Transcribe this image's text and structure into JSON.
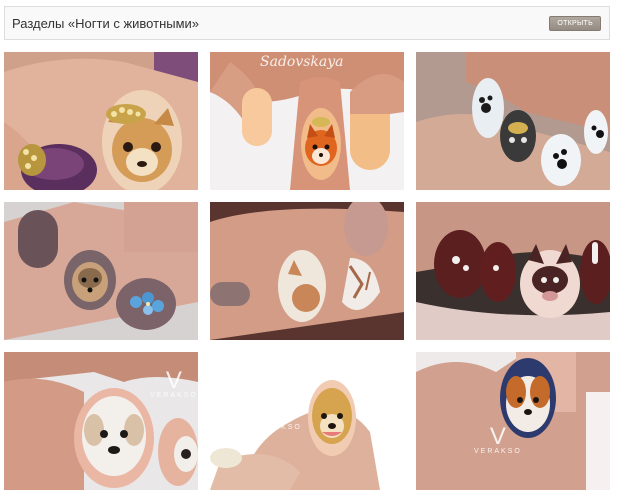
{
  "header": {
    "title": "Разделы «Ногти с животными»",
    "open_button": "ОТКРЫТЬ"
  },
  "gallery": {
    "tiles": [
      {
        "theme": "purple nails with gold crystals and chihuahua portrait"
      },
      {
        "theme": "peach almond nails with orange fox",
        "watermark": "Sadovskaya"
      },
      {
        "theme": "white nails with black paw prints and dog"
      },
      {
        "theme": "mauve nails with yorkie and blue flowers"
      },
      {
        "theme": "nude nails with white fox"
      },
      {
        "theme": "burgundy nails with french bulldog and paws"
      },
      {
        "theme": "white maltese dog portrait nail",
        "watermark": "VERAKSO"
      },
      {
        "theme": "pomeranian portrait nail",
        "watermark": "VERAKSO"
      },
      {
        "theme": "navy nail with beagle portrait",
        "watermark": "VERAKSO"
      }
    ]
  },
  "colors": {
    "header_bg": "#f9f9f9",
    "button_bg": "#a39b92",
    "skin": "#e5b89f"
  }
}
